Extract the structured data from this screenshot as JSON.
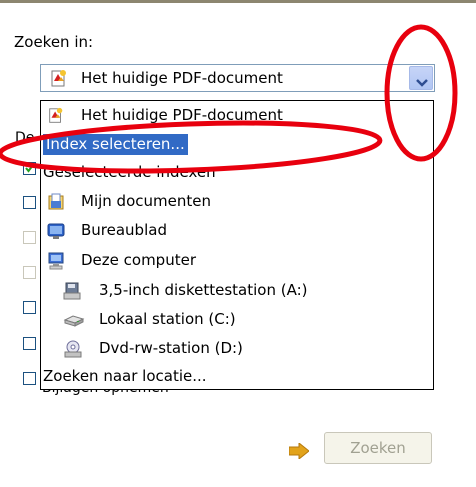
{
  "search_in_label": "Zoeken in:",
  "combo": {
    "selected": "Het huidige PDF-document"
  },
  "background_labels": {
    "partial_label": "De",
    "partial_option": "Bijlagen opnemen"
  },
  "dropdown": {
    "items": [
      {
        "label": "Het huidige PDF-document",
        "icon": "pdf-document-icon"
      },
      {
        "label": "Index selecteren...",
        "icon": "",
        "selected": true
      },
      {
        "label": "Geselecteerde indexen",
        "icon": ""
      },
      {
        "label": "Mijn documenten",
        "icon": "my-documents-icon"
      },
      {
        "label": "Bureaublad",
        "icon": "desktop-icon"
      },
      {
        "label": "Deze computer",
        "icon": "computer-icon"
      },
      {
        "label": "3,5-inch diskettestation (A:)",
        "icon": "floppy-drive-icon"
      },
      {
        "label": "Lokaal station (C:)",
        "icon": "hard-drive-icon"
      },
      {
        "label": "Dvd-rw-station (D:)",
        "icon": "dvd-drive-icon"
      },
      {
        "label": "Zoeken naar locatie...",
        "icon": ""
      }
    ]
  },
  "search_button": {
    "label": "Zoeken"
  },
  "colors": {
    "selection": "#316ac5",
    "annotation": "#e8000e",
    "combo_border": "#7f9db9"
  }
}
